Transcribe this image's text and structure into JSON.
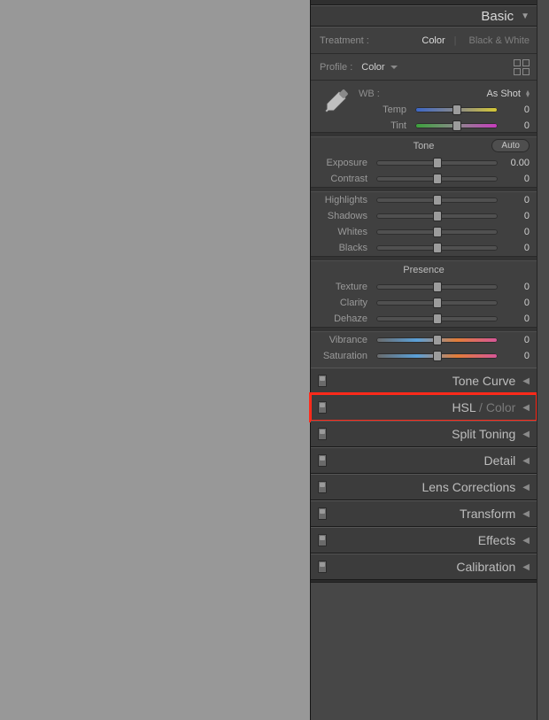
{
  "basic": {
    "title": "Basic",
    "treatment_label": "Treatment :",
    "treatment_options": {
      "color": "Color",
      "bw": "Black & White"
    },
    "profile_label": "Profile :",
    "profile_value": "Color",
    "wb_label": "WB :",
    "wb_value": "As Shot",
    "sliders": {
      "temp": {
        "label": "Temp",
        "value": "0"
      },
      "tint": {
        "label": "Tint",
        "value": "0"
      },
      "tone_section": "Tone",
      "auto_label": "Auto",
      "exposure": {
        "label": "Exposure",
        "value": "0.00"
      },
      "contrast": {
        "label": "Contrast",
        "value": "0"
      },
      "highlights": {
        "label": "Highlights",
        "value": "0"
      },
      "shadows": {
        "label": "Shadows",
        "value": "0"
      },
      "whites": {
        "label": "Whites",
        "value": "0"
      },
      "blacks": {
        "label": "Blacks",
        "value": "0"
      },
      "presence_section": "Presence",
      "texture": {
        "label": "Texture",
        "value": "0"
      },
      "clarity": {
        "label": "Clarity",
        "value": "0"
      },
      "dehaze": {
        "label": "Dehaze",
        "value": "0"
      },
      "vibrance": {
        "label": "Vibrance",
        "value": "0"
      },
      "saturation": {
        "label": "Saturation",
        "value": "0"
      }
    }
  },
  "panels": {
    "tone_curve": "Tone Curve",
    "hsl": "HSL",
    "hsl_sep": " / ",
    "hsl_color": "Color",
    "split_toning": "Split Toning",
    "detail": "Detail",
    "lens_corrections": "Lens Corrections",
    "transform": "Transform",
    "effects": "Effects",
    "calibration": "Calibration"
  },
  "colors": {
    "highlight": "#ff2a1a"
  }
}
